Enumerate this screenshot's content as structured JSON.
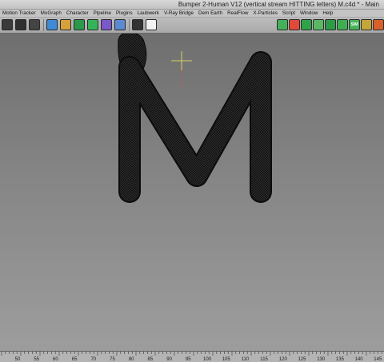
{
  "window": {
    "title": "Bumper 2-Human V12 (vertical stream HITTING letters) M.c4d * - Main"
  },
  "menu": {
    "items": [
      {
        "label": "Motion Tracker"
      },
      {
        "label": "MoGraph"
      },
      {
        "label": "Character"
      },
      {
        "label": "Pipeline"
      },
      {
        "label": "Plugins"
      },
      {
        "label": "Laubwerk"
      },
      {
        "label": "V-Ray Bridge"
      },
      {
        "label": "Dem Earth"
      },
      {
        "label": "RealFlow"
      },
      {
        "label": "X-Particles"
      },
      {
        "label": "Script"
      },
      {
        "label": "Window"
      },
      {
        "label": "Help"
      }
    ]
  },
  "toolbar": {
    "left_tools": [
      {
        "icon": "render-region-icon",
        "color": "#3a3a3a"
      },
      {
        "icon": "render-view-icon",
        "color": "#2f2f2f"
      },
      {
        "icon": "render-settings-icon",
        "color": "#444444"
      },
      {
        "icon": "cube-icon",
        "color": "#3e8ad6"
      },
      {
        "icon": "pen-icon",
        "color": "#d7a13a"
      },
      {
        "icon": "subdivision-icon",
        "color": "#2a9a4a"
      },
      {
        "icon": "cloner-icon",
        "color": "#36b35a"
      },
      {
        "icon": "deformer-icon",
        "color": "#7b58c8"
      },
      {
        "icon": "scene-icon",
        "color": "#5a8bd0"
      },
      {
        "icon": "camera-icon",
        "color": "#333333"
      },
      {
        "icon": "light-icon",
        "color": "#f2f2f2"
      }
    ],
    "right_tools": [
      {
        "icon": "xp-system-icon",
        "color": "#44b05a"
      },
      {
        "icon": "xp-emitter-icon",
        "color": "#e04a3a"
      },
      {
        "icon": "xp-generator-icon",
        "color": "#2fa24a"
      },
      {
        "icon": "xp-question-icon",
        "color": "#5ab865"
      },
      {
        "icon": "xp-modifier-icon",
        "color": "#2d9b46"
      },
      {
        "icon": "xp-dynamics-icon",
        "color": "#3fae52"
      },
      {
        "icon": "xp-sim-icon",
        "color": "#46b35a"
      },
      {
        "icon": "xp-cache-icon",
        "color": "#c4a53a"
      },
      {
        "icon": "xp-fx-icon",
        "color": "#d8602a"
      }
    ],
    "sim_label": "SIM"
  },
  "viewport": {
    "object_letter": "M",
    "axis_color": "#d8d060",
    "y_axis_color": "#e05050"
  },
  "timeline": {
    "ticks": [
      "50",
      "55",
      "60",
      "65",
      "70",
      "75",
      "80",
      "85",
      "90",
      "95",
      "100",
      "105",
      "110",
      "115",
      "120",
      "125",
      "130",
      "135",
      "140",
      "145"
    ]
  }
}
